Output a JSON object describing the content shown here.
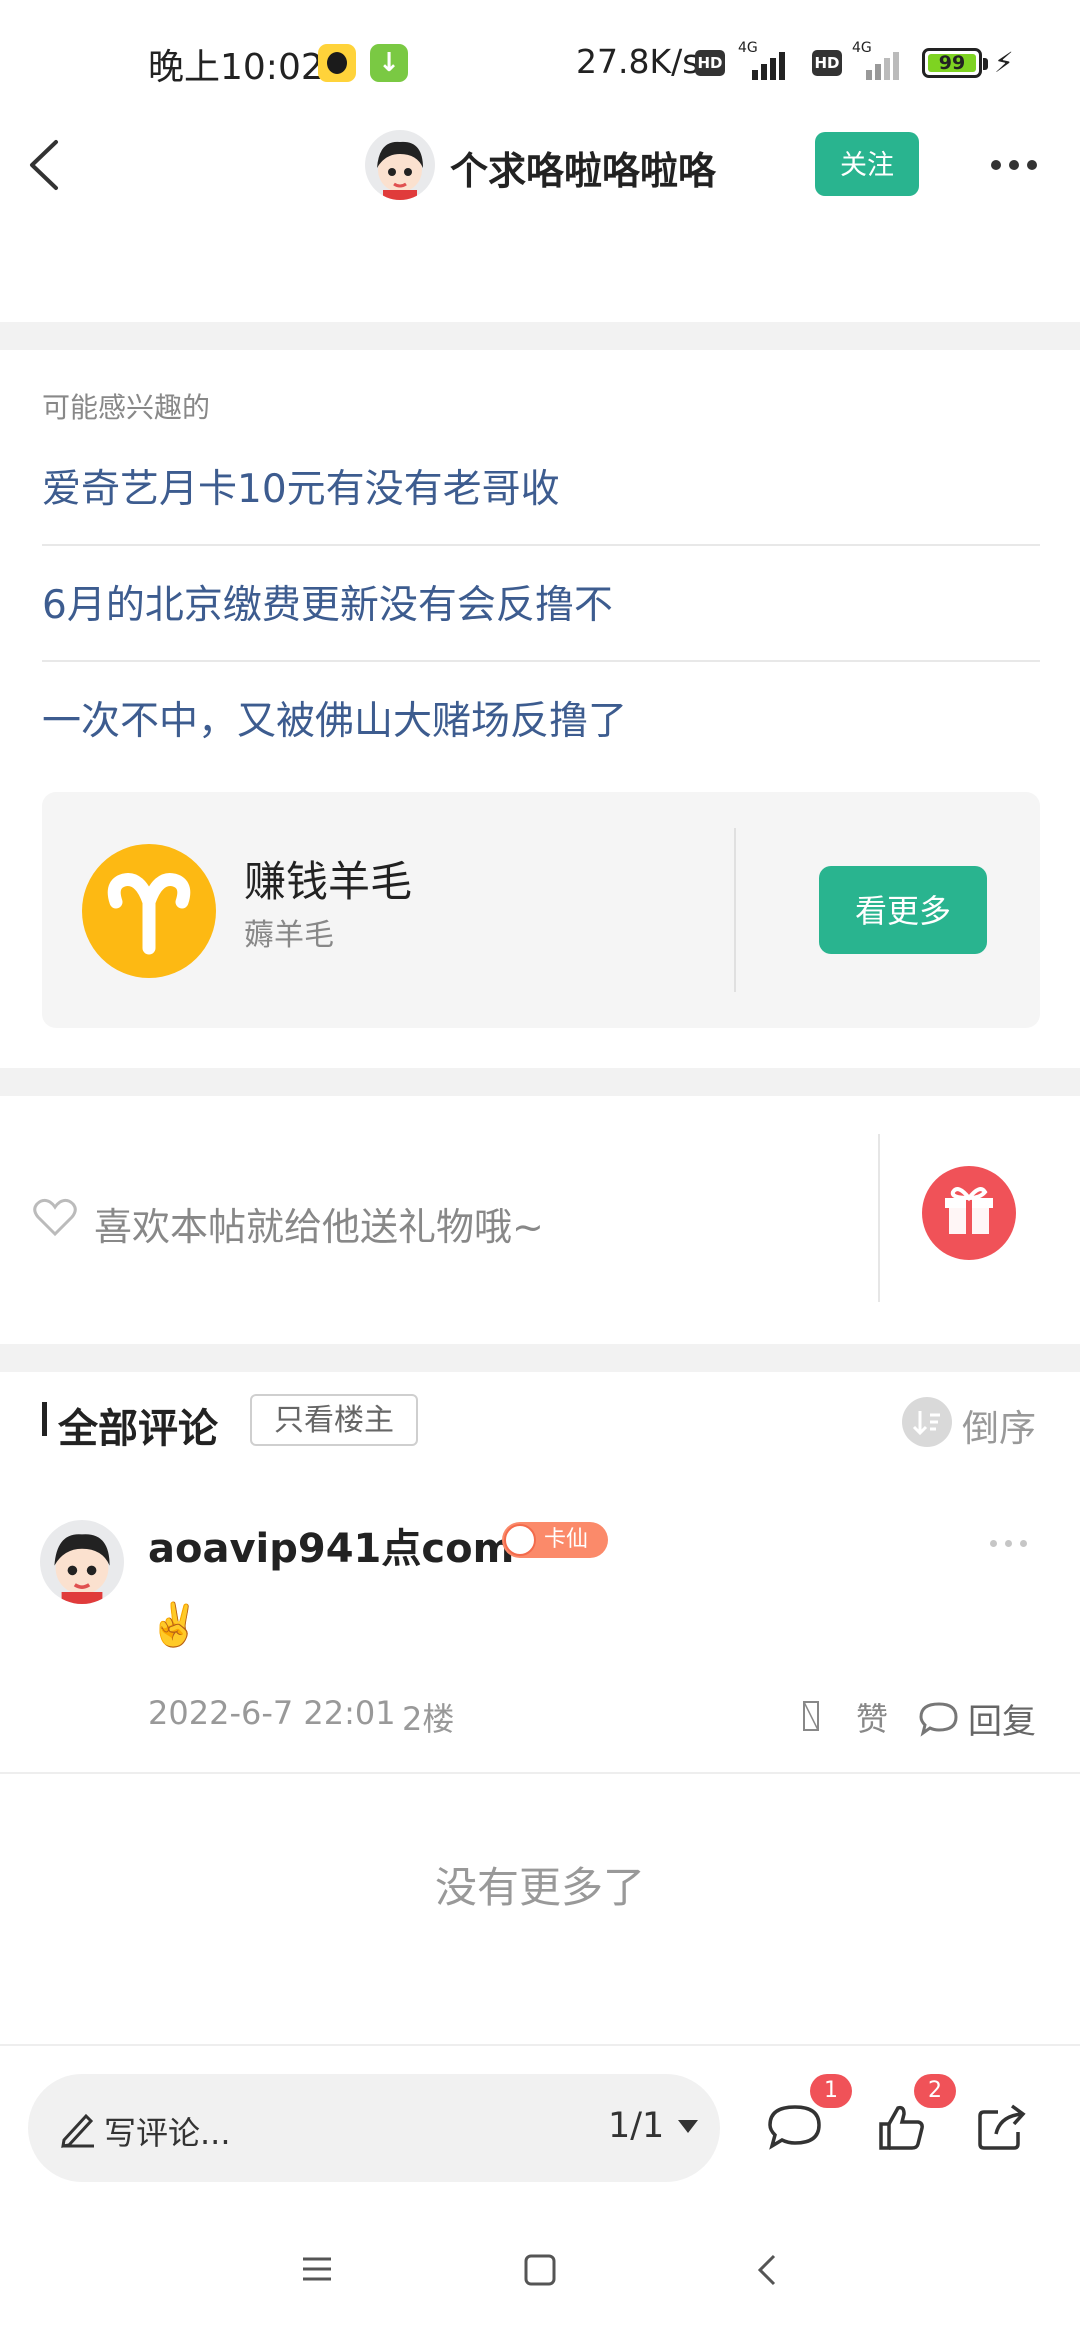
{
  "status_bar": {
    "time": "晚上10:02",
    "net_speed": "27.8K/s",
    "hd1": "HD",
    "hd2": "HD",
    "sim1": "4G",
    "sim2": "4G",
    "battery": "99"
  },
  "header": {
    "title": "个求咯啦咯啦咯",
    "follow_label": "关注"
  },
  "recommend": {
    "label": "可能感兴趣的",
    "items": [
      "爱奇艺月卡10元有没有老哥收",
      "6月的北京缴费更新没有会反撸不",
      "一次不中，又被佛山大赌场反撸了"
    ]
  },
  "topic": {
    "name": "赚钱羊毛",
    "sub": "薅羊毛",
    "see_more_label": "看更多"
  },
  "gift": {
    "prompt": "喜欢本帖就给他送礼物哦~"
  },
  "comments": {
    "title": "全部评论",
    "only_op_label": "只看楼主",
    "sort_label": "倒序",
    "items": [
      {
        "user": "aoavip941点com",
        "badge": "卡仙",
        "content": "✌️",
        "time": "2022-6-7 22:01",
        "floor": "2楼",
        "like_label": "赞",
        "reply_label": "回复"
      }
    ],
    "no_more": "没有更多了"
  },
  "bottom_bar": {
    "compose_placeholder": "写评论...",
    "page_indicator": "1/1",
    "comment_count": "1",
    "like_count": "2"
  },
  "colors": {
    "accent": "#29b48f",
    "link": "#3d5c8f",
    "topic_icon": "#fdb913",
    "gift": "#f05258"
  }
}
